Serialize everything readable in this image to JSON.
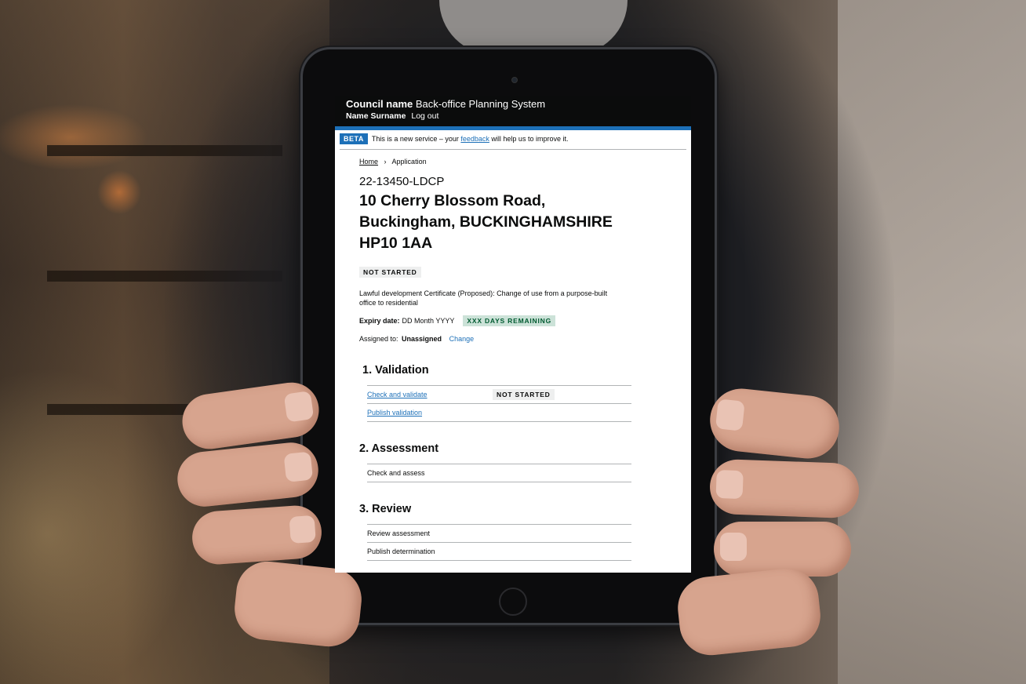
{
  "header": {
    "council_name": "Council name",
    "system_name": "Back-office Planning System",
    "user_name": "Name Surname",
    "logout_label": "Log out"
  },
  "beta_banner": {
    "tag": "BETA",
    "text_before": "This is a new service – your ",
    "link": "feedback",
    "text_after": " will help us to improve it."
  },
  "breadcrumb": {
    "home": "Home",
    "current": "Application"
  },
  "application": {
    "reference": "22-13450-LDCP",
    "address": "10 Cherry Blossom Road, Buckingham, BUCKINGHAMSHIRE HP10 1AA",
    "status": "NOT STARTED",
    "description": "Lawful development Certificate (Proposed): Change of use from a purpose-built office to residential",
    "expiry_label": "Expiry date:",
    "expiry_value": "DD Month YYYY",
    "days_remaining": "XXX DAYS REMAINING",
    "assigned_label": "Assigned to:",
    "assigned_value": "Unassigned",
    "change_label": "Change"
  },
  "sections": {
    "validation": {
      "title": "1. Validation",
      "tasks": [
        {
          "label": "Check and validate",
          "status": "NOT STARTED"
        },
        {
          "label": "Publish validation"
        }
      ]
    },
    "assessment": {
      "title": "2. Assessment",
      "tasks": [
        {
          "label": "Check and assess"
        }
      ]
    },
    "review": {
      "title": "3. Review",
      "tasks": [
        {
          "label": "Review assessment"
        },
        {
          "label": "Publish determination"
        }
      ]
    }
  },
  "colors": {
    "header_bg": "#0b0c0c",
    "accent_blue": "#1d70b8",
    "tag_grey": "#eeefef",
    "tag_green_bg": "#cce2d8",
    "tag_green_text": "#005a30"
  }
}
